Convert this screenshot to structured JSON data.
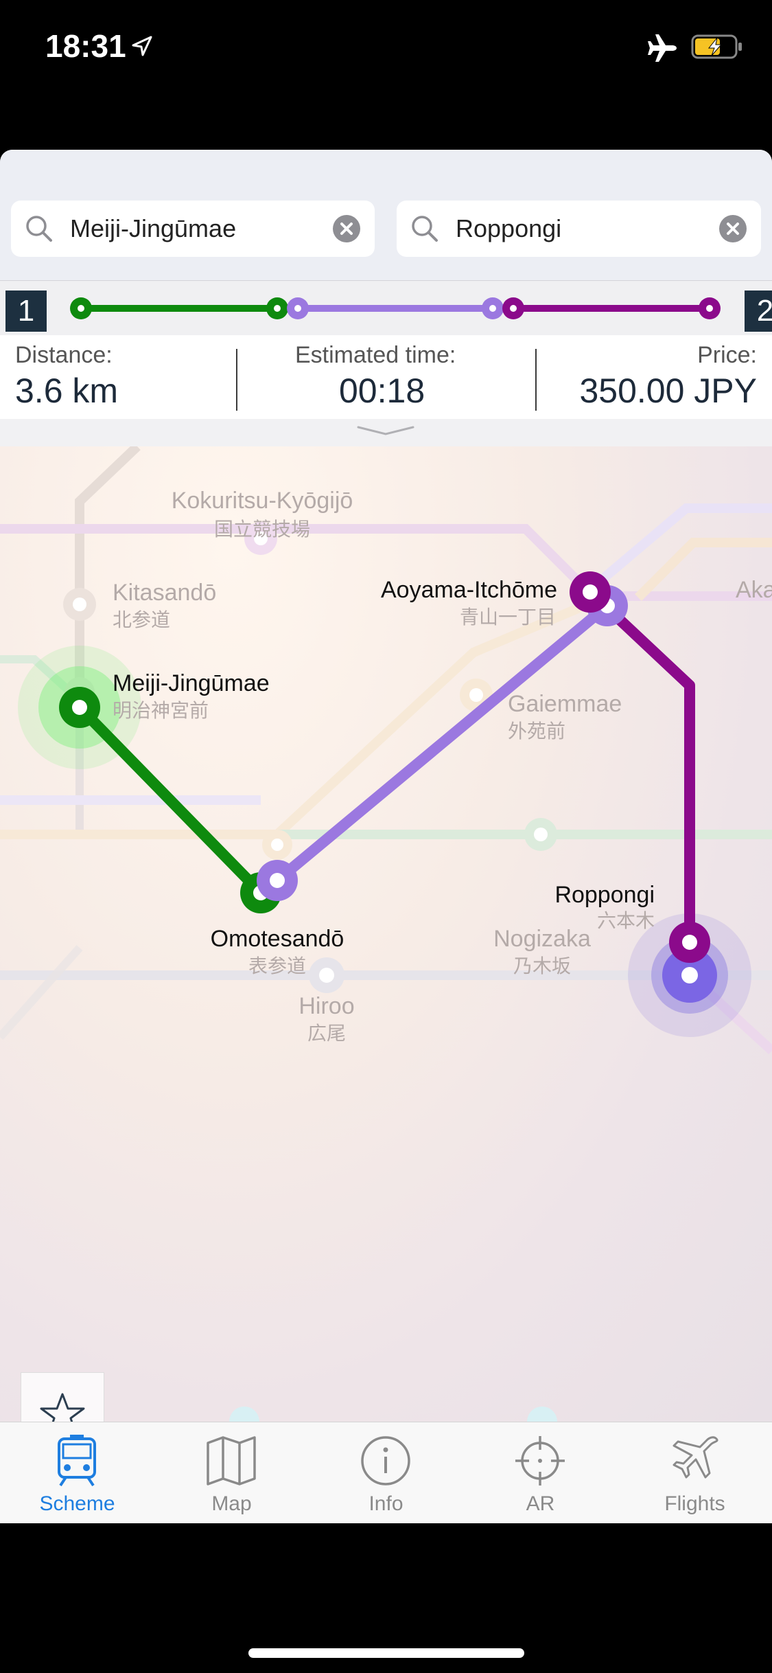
{
  "status_bar": {
    "time": "18:31",
    "icons": [
      "location-arrow-icon",
      "airplane-mode-icon",
      "battery-charging-icon"
    ]
  },
  "search": {
    "from": {
      "value": "Meiji-Jingūmae",
      "icon": "search-icon"
    },
    "to": {
      "value": "Roppongi",
      "icon": "search-icon"
    }
  },
  "route": {
    "current_index": "1",
    "next_index": "2",
    "segments_colors": [
      "#0e8a0e",
      "#9b78e0",
      "#8b0a8b"
    ]
  },
  "stats": {
    "distance_label": "Distance:",
    "distance_value": "3.6 km",
    "time_label": "Estimated time:",
    "time_value": "00:18",
    "price_label": "Price:",
    "price_value": "350.00 JPY"
  },
  "map": {
    "stations": [
      {
        "id": "kokuritsu",
        "en": "Kokuritsu-Kyōgijō",
        "jp": "国立競技場",
        "on_route": false
      },
      {
        "id": "kitasando",
        "en": "Kitasandō",
        "jp": "北参道",
        "on_route": false
      },
      {
        "id": "meiji",
        "en": "Meiji-Jingūmae",
        "jp": "明治神宮前",
        "on_route": true
      },
      {
        "id": "aoyama",
        "en": "Aoyama-Itchōme",
        "jp": "青山一丁目",
        "on_route": true
      },
      {
        "id": "gaiemmae",
        "en": "Gaiemmae",
        "jp": "外苑前",
        "on_route": false
      },
      {
        "id": "omotesando",
        "en": "Omotesandō",
        "jp": "表参道",
        "on_route": true
      },
      {
        "id": "nogizaka",
        "en": "Nogizaka",
        "jp": "乃木坂",
        "on_route": false
      },
      {
        "id": "roppongi",
        "en": "Roppongi",
        "jp": "六本木",
        "on_route": true
      },
      {
        "id": "hiroo",
        "en": "Hiroo",
        "jp": "広尾",
        "on_route": false
      }
    ],
    "clipped_labels": {
      "aka": "Aka"
    }
  },
  "side_buttons": {
    "favorite_icon": "star-icon",
    "person_icon": "person-location-icon"
  },
  "tabs": [
    {
      "label": "Scheme",
      "icon": "train-icon",
      "active": true
    },
    {
      "label": "Map",
      "icon": "map-icon",
      "active": false
    },
    {
      "label": "Info",
      "icon": "info-icon",
      "active": false
    },
    {
      "label": "AR",
      "icon": "crosshair-icon",
      "active": false
    },
    {
      "label": "Flights",
      "icon": "airplane-icon",
      "active": false
    }
  ]
}
